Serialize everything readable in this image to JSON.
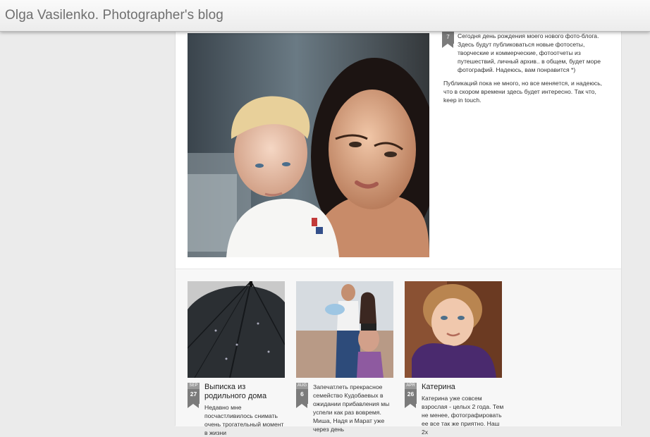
{
  "header": {
    "title": "Olga Vasilenko. Photographer's blog"
  },
  "hero_post": {
    "date_day": "7",
    "paragraphs": [
      "Сегодня день рождения моего нового фото-блога. Здесь будут публиковаться новые фотосеты, творческие и коммерческие, фотоотчеты из путешествий, личный архив.. в общем, будет море фотографий. Надеюсь, вам понравится *)",
      "Публикаций пока не много, но все меняется, и надеюсь, что в скором времени здесь будет интересно. Так что, keep in touch."
    ]
  },
  "posts": [
    {
      "month": "SEP",
      "day": "27",
      "title": "Выписка из родильного дома",
      "excerpt": "Недавно мне посчастливилось снимать очень трогательный момент в жизни"
    },
    {
      "month": "AUG",
      "day": "6",
      "title": "",
      "excerpt": "Запечатлеть прекрасное семейство Кудобаевых в ожидании прибавления мы успели как раз вовремя. Миша, Надя и Марат уже через день"
    },
    {
      "month": "APR",
      "day": "26",
      "title": "Катерина",
      "excerpt": "Катерина уже совсем взрослая - целых 2 года. Тем не менее, фотографировать ее все так же приятно. Наш 2х"
    }
  ]
}
